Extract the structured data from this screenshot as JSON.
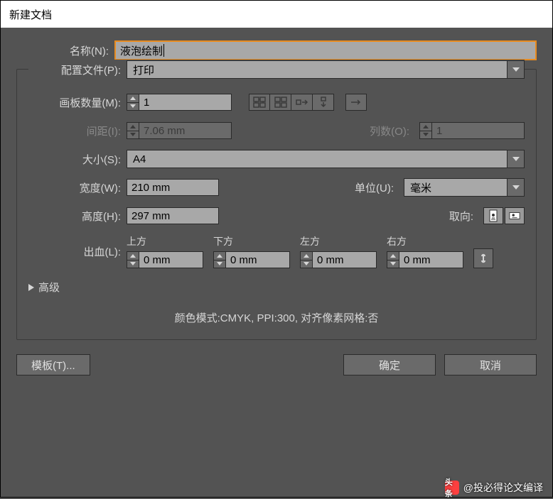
{
  "title": "新建文档",
  "labels": {
    "name": "名称(N):",
    "profile": "配置文件(P):",
    "artboards": "画板数量(M):",
    "spacing": "间距(I):",
    "columns": "列数(O):",
    "size": "大小(S):",
    "width": "宽度(W):",
    "height": "高度(H):",
    "units": "单位(U):",
    "orientation": "取向:",
    "bleed": "出血(L):",
    "advanced": "高级"
  },
  "fields": {
    "name": "液泡绘制",
    "profile": "打印",
    "artboards": "1",
    "spacing": "7.06 mm",
    "columns": "1",
    "size": "A4",
    "width": "210 mm",
    "height": "297 mm",
    "units": "毫米"
  },
  "bleed": {
    "top_label": "上方",
    "bottom_label": "下方",
    "left_label": "左方",
    "right_label": "右方",
    "top": "0 mm",
    "bottom": "0 mm",
    "left": "0 mm",
    "right": "0 mm"
  },
  "info": "颜色模式:CMYK, PPI:300, 对齐像素网格:否",
  "buttons": {
    "templates": "模板(T)...",
    "ok": "确定",
    "cancel": "取消"
  },
  "watermark": {
    "logo": "头条",
    "text": "@投必得论文编译"
  }
}
